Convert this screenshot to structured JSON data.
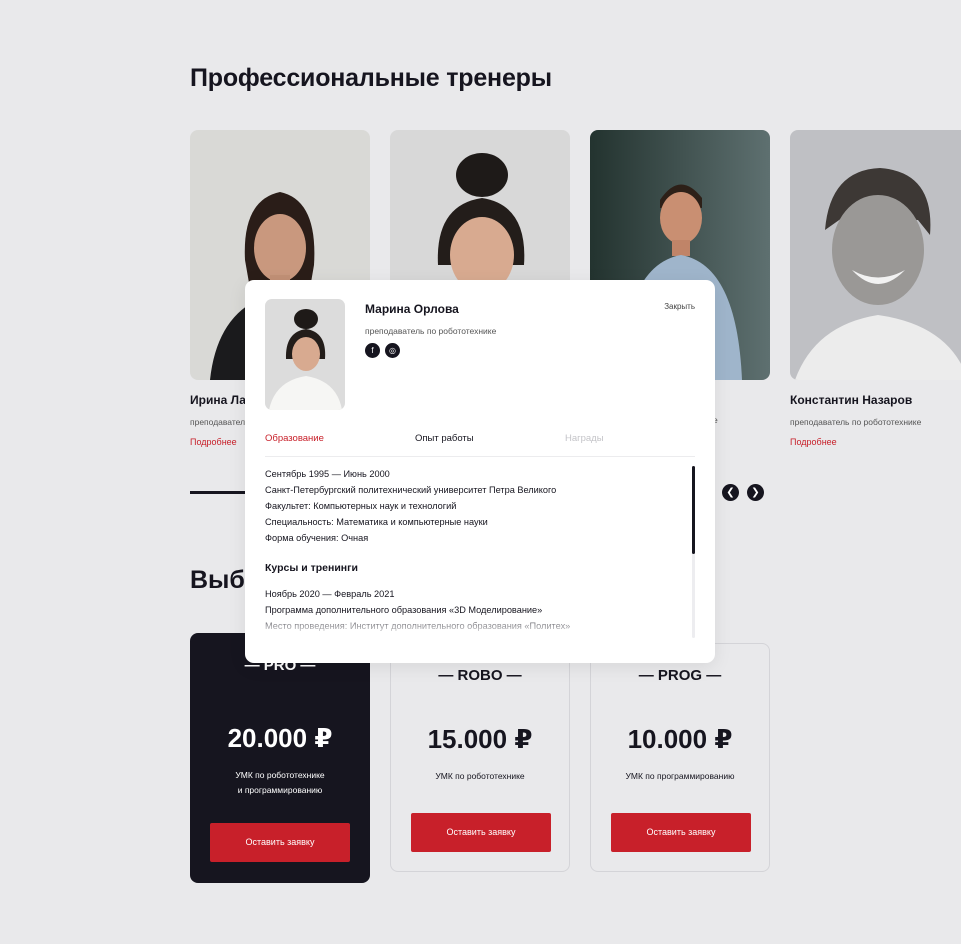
{
  "trainers_section": {
    "title": "Профессиональные тренеры"
  },
  "trainers": [
    {
      "name": "Ирина Ла",
      "role": "преподавател",
      "more": "Подробнее"
    },
    {
      "name": "",
      "role": "",
      "more": ""
    },
    {
      "name": "",
      "role": "ювание",
      "more": ""
    },
    {
      "name": "Константин Назаров",
      "role": "преподаватель по робототехнике",
      "more": "Подробнее"
    }
  ],
  "slider": {
    "prev_icon": "chevron-left-icon",
    "next_icon": "chevron-right-icon"
  },
  "plans_section": {
    "title": "Выбе"
  },
  "plans": [
    {
      "name": "— PRO —",
      "price": "20.000 ₽",
      "desc_line1": "УМК по робототехнике",
      "desc_line2": "и программированию",
      "button": "Оставить заявку"
    },
    {
      "name": "— ROBO —",
      "price": "15.000 ₽",
      "desc_line1": "УМК по робототехнике",
      "desc_line2": "",
      "button": "Оставить заявку"
    },
    {
      "name": "— PROG —",
      "price": "10.000 ₽",
      "desc_line1": "УМК по программированию",
      "desc_line2": "",
      "button": "Оставить заявку"
    }
  ],
  "modal": {
    "name": "Марина Орлова",
    "role": "преподаватель по робототехнике",
    "close": "Закрыть",
    "socials": {
      "facebook": "f",
      "instagram": "◎"
    },
    "tabs": [
      "Образование",
      "Опыт работы",
      "Награды"
    ],
    "education": [
      "Сентябрь 1995 — Июнь 2000",
      "Санкт-Петербургский политехнический университет Петра Великого",
      "Факультет: Компьютерных наук и технологий",
      "Специальность: Математика и компьютерные науки",
      "Форма обучения: Очная"
    ],
    "courses_title": "Курсы и тренинги",
    "courses": [
      "Ноябрь 2020 — Февраль 2021",
      "Программа дополнительного образования «3D Моделирование»",
      "Место проведения: Институт дополнительного образования «Политех»"
    ]
  },
  "colors": {
    "accent": "#c8202a",
    "dark": "#16151f",
    "background": "#e9e9eb"
  }
}
